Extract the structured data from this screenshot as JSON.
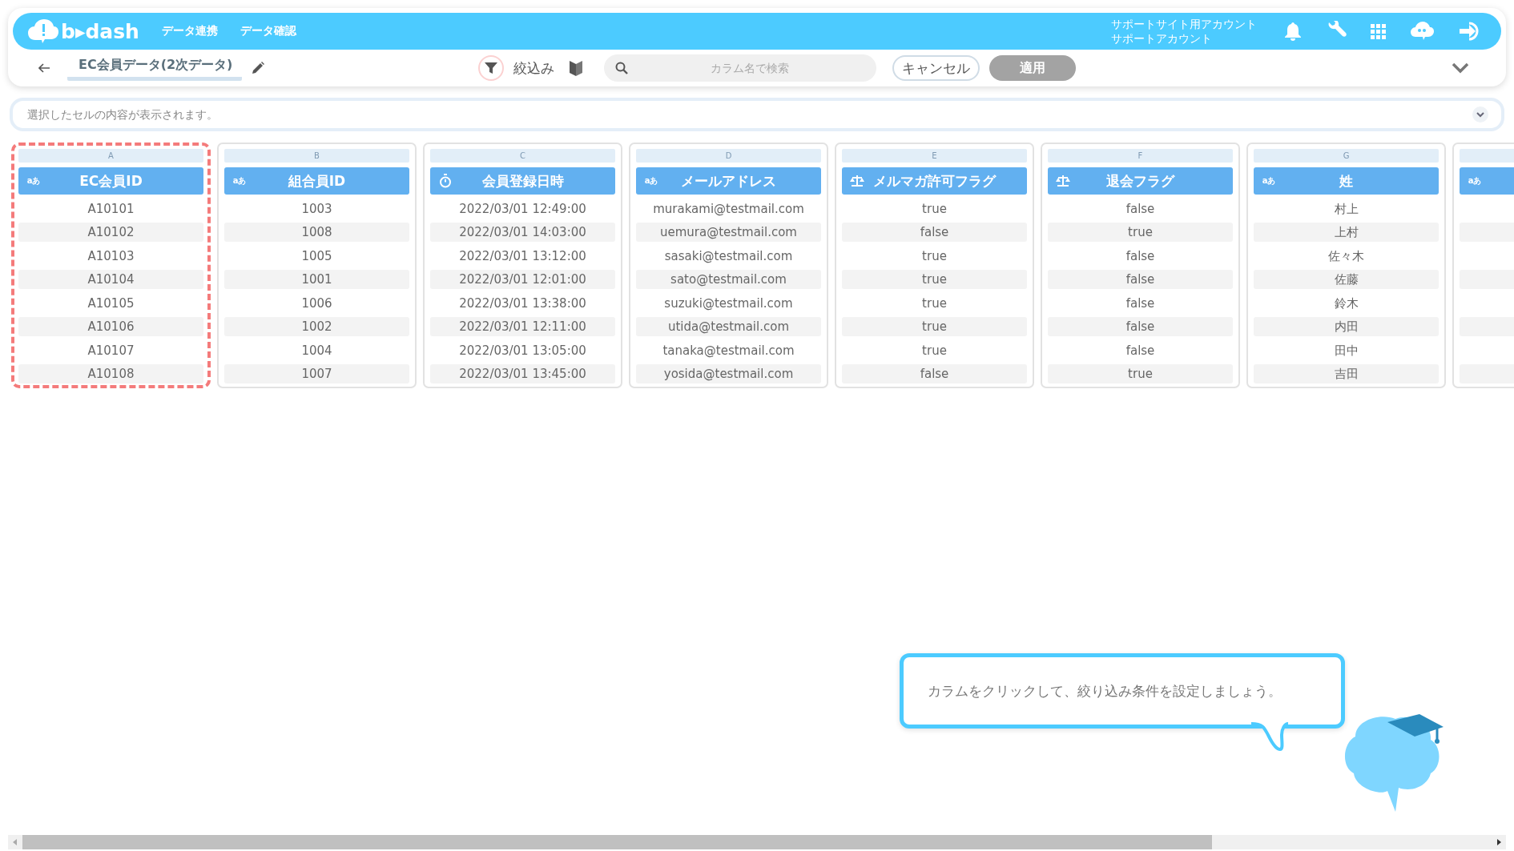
{
  "header": {
    "logo": "b▸dash",
    "nav": [
      "データ連携",
      "データ確認"
    ],
    "account": [
      "サポートサイト用アカウント",
      "サポートアカウント"
    ]
  },
  "toolbar": {
    "title": "EC会員データ(2次データ)",
    "filter_label": "絞込み",
    "search": {
      "placeholder": "カラム名で検索"
    },
    "cancel": "キャンセル",
    "apply": {
      "label": "適用",
      "disabled": true
    }
  },
  "cell_view": {
    "placeholder": "選択したセルの内容が表示されます。"
  },
  "columns": [
    {
      "letter": "A",
      "name": "EC会員ID",
      "kind": "text",
      "badge": "aあ",
      "selected": true
    },
    {
      "letter": "B",
      "name": "組合員ID",
      "kind": "text",
      "badge": "aあ",
      "selected": false
    },
    {
      "letter": "C",
      "name": "会員登録日時",
      "kind": "datetime",
      "selected": false
    },
    {
      "letter": "D",
      "name": "メールアドレス",
      "kind": "text",
      "badge": "aあ",
      "selected": false
    },
    {
      "letter": "E",
      "name": "メルマガ許可フラグ",
      "kind": "boolean",
      "selected": false
    },
    {
      "letter": "F",
      "name": "退会フラグ",
      "kind": "boolean",
      "selected": false
    },
    {
      "letter": "G",
      "name": "姓",
      "kind": "text",
      "badge": "aあ",
      "selected": false
    },
    {
      "kind": "text",
      "badge": "aあ",
      "selected": false
    }
  ],
  "rows": [
    [
      "A10101",
      "1003",
      "2022/03/01 12:49:00",
      "murakami@testmail.com",
      "true",
      "false",
      "村上"
    ],
    [
      "A10102",
      "1008",
      "2022/03/01 14:03:00",
      "uemura@testmail.com",
      "false",
      "true",
      "上村"
    ],
    [
      "A10103",
      "1005",
      "2022/03/01 13:12:00",
      "sasaki@testmail.com",
      "true",
      "false",
      "佐々木"
    ],
    [
      "A10104",
      "1001",
      "2022/03/01 12:01:00",
      "sato@testmail.com",
      "true",
      "false",
      "佐藤"
    ],
    [
      "A10105",
      "1006",
      "2022/03/01 13:38:00",
      "suzuki@testmail.com",
      "true",
      "false",
      "鈴木"
    ],
    [
      "A10106",
      "1002",
      "2022/03/01 12:11:00",
      "utida@testmail.com",
      "true",
      "false",
      "内田"
    ],
    [
      "A10107",
      "1004",
      "2022/03/01 13:05:00",
      "tanaka@testmail.com",
      "true",
      "false",
      "田中"
    ],
    [
      "A10108",
      "1007",
      "2022/03/01 13:45:00",
      "yosida@testmail.com",
      "false",
      "true",
      "吉田"
    ]
  ],
  "hint": "カラムをクリックして、絞り込み条件を設定しましょう。"
}
